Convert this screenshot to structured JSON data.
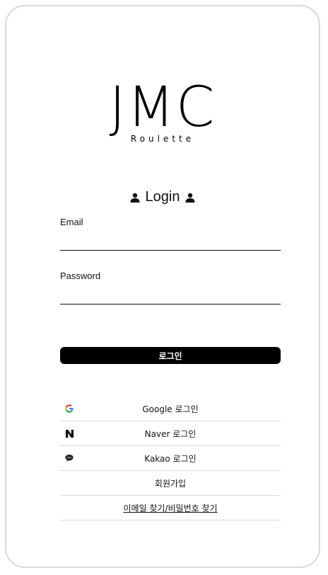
{
  "logo": {
    "title": "JMC",
    "subtitle": "Roulette"
  },
  "login_heading": "Login",
  "form": {
    "email_label": "Email",
    "email_value": "",
    "password_label": "Password",
    "password_value": ""
  },
  "login_button": "로그인",
  "social": {
    "google": "Google 로그인",
    "naver": "Naver 로그인",
    "kakao": "Kakao 로그인",
    "signup": "회원가입",
    "find": "이메일 찾기/비밀번호 찾기"
  },
  "icons": {
    "user": "user-icon",
    "google": "google-icon",
    "naver": "naver-icon",
    "kakao": "kakao-icon"
  },
  "colors": {
    "primary": "#000000",
    "divider": "#dcdcdc",
    "google_blue": "#4285F4",
    "google_red": "#EA4335",
    "google_yellow": "#FBBC05",
    "google_green": "#34A853"
  }
}
